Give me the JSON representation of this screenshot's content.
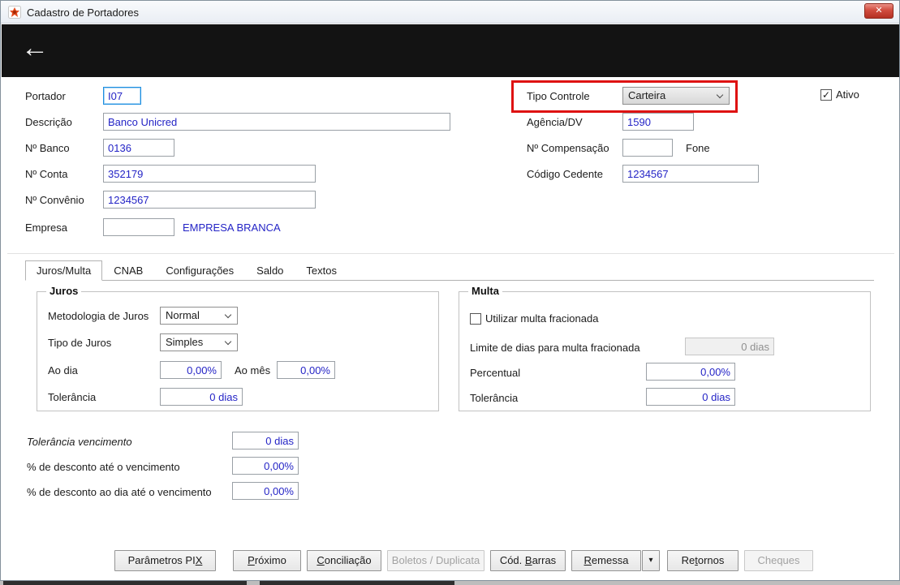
{
  "window": {
    "title": "Cadastro de Portadores"
  },
  "icons": {
    "back": "←",
    "close": "✕",
    "check": "✓",
    "menu_arrow": "▾"
  },
  "header": {
    "portador": {
      "label": "Portador",
      "value": "I07"
    },
    "descricao": {
      "label": "Descrição",
      "value": "Banco Unicred"
    },
    "n_banco": {
      "label": "Nº Banco",
      "value": "0136"
    },
    "n_conta": {
      "label": "Nº Conta",
      "value": "352179"
    },
    "n_convenio": {
      "label": "Nº Convênio",
      "value": "1234567"
    },
    "empresa": {
      "label": "Empresa",
      "value": "",
      "display_name": "EMPRESA BRANCA"
    },
    "tipo_controle": {
      "label": "Tipo Controle",
      "value": "Carteira"
    },
    "agencia_dv": {
      "label": "Agência/DV",
      "value": "1590"
    },
    "n_compensacao": {
      "label": "Nº Compensação",
      "value": ""
    },
    "fone": {
      "label": "Fone"
    },
    "codigo_cedente": {
      "label": "Código Cedente",
      "value": "1234567"
    },
    "ativo": {
      "label": "Ativo",
      "checked": true
    }
  },
  "tabs": [
    {
      "label": "Juros/Multa"
    },
    {
      "label": "CNAB"
    },
    {
      "label": "Configurações"
    },
    {
      "label": "Saldo"
    },
    {
      "label": "Textos"
    }
  ],
  "juros": {
    "title": "Juros",
    "metodologia": {
      "label": "Metodologia de Juros",
      "value": "Normal"
    },
    "tipo": {
      "label": "Tipo de Juros",
      "value": "Simples"
    },
    "ao_dia": {
      "label": "Ao dia",
      "value": "0,00%"
    },
    "ao_mes": {
      "label": "Ao mês",
      "value": "0,00%"
    },
    "tolerancia": {
      "label": "Tolerância",
      "value": "0 dias"
    }
  },
  "multa": {
    "title": "Multa",
    "fracionada": {
      "label": "Utilizar multa fracionada",
      "checked": false
    },
    "limite": {
      "label": "Limite de dias para multa fracionada",
      "value": "0 dias"
    },
    "percentual": {
      "label": "Percentual",
      "value": "0,00%"
    },
    "tolerancia": {
      "label": "Tolerância",
      "value": "0 dias"
    }
  },
  "descontos": {
    "tolerancia_vencimento": {
      "label": "Tolerância vencimento",
      "value": "0 dias"
    },
    "desconto_ate": {
      "label": "% de desconto até o vencimento",
      "value": "0,00%"
    },
    "desconto_dia": {
      "label": "% de desconto ao dia até o vencimento",
      "value": "0,00%"
    }
  },
  "footer": {
    "buttons": [
      {
        "pre": "Parâmetros PI",
        "key": "X",
        "post": ""
      },
      {
        "pre": "",
        "key": "P",
        "post": "róximo"
      },
      {
        "pre": "",
        "key": "C",
        "post": "onciliação"
      },
      {
        "pre": "Boletos / Duplicata",
        "key": "",
        "post": ""
      },
      {
        "pre": "Cód. ",
        "key": "B",
        "post": "arras"
      },
      {
        "pre": "",
        "key": "R",
        "post": "emessa"
      },
      {
        "pre": "Re",
        "key": "t",
        "post": "ornos"
      },
      {
        "pre": "Cheques",
        "key": "",
        "post": ""
      }
    ]
  }
}
